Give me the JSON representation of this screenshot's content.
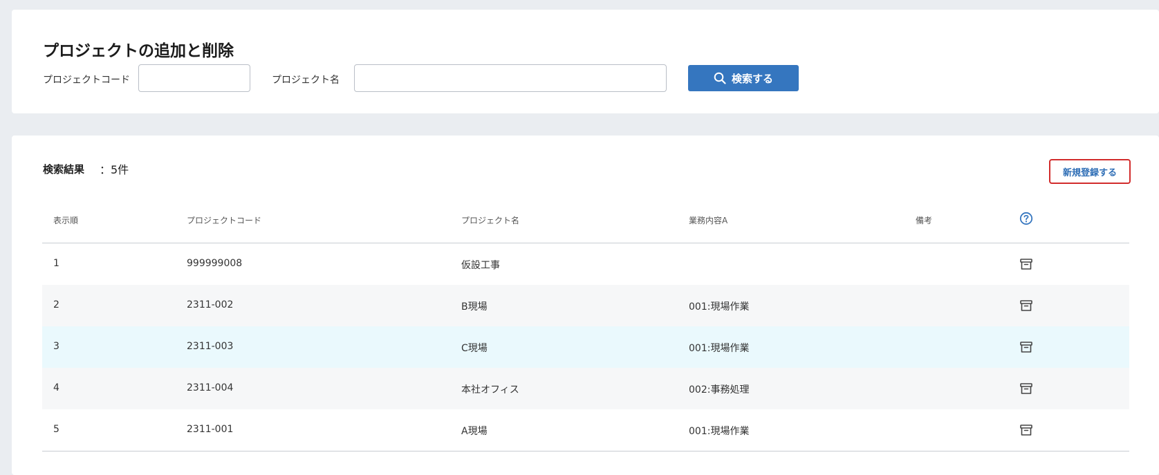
{
  "search": {
    "title": "プロジェクトの追加と削除",
    "code_label": "プロジェクトコード",
    "code_value": "",
    "name_label": "プロジェクト名",
    "name_value": "",
    "button_label": "検索する"
  },
  "results": {
    "label": "検索結果",
    "count": "：5件",
    "new_button_label": "新規登録する",
    "columns": [
      "表示順",
      "プロジェクトコード",
      "プロジェクト名",
      "業務内容A",
      "備考"
    ],
    "rows": [
      {
        "order": "1",
        "code": "999999008",
        "name": "仮設工事",
        "work": "",
        "note": ""
      },
      {
        "order": "2",
        "code": "2311-002",
        "name": "B現場",
        "work": "001:現場作業",
        "note": ""
      },
      {
        "order": "3",
        "code": "2311-003",
        "name": "C現場",
        "work": "001:現場作業",
        "note": ""
      },
      {
        "order": "4",
        "code": "2311-004",
        "name": "本社オフィス",
        "work": "002:事務処理",
        "note": ""
      },
      {
        "order": "5",
        "code": "2311-001",
        "name": "A現場",
        "work": "001:現場作業",
        "note": ""
      }
    ]
  },
  "icons": {
    "search": "search-icon",
    "help": "help-circle-icon",
    "row_action": "archive-icon"
  },
  "colors": {
    "primary": "#3576bf",
    "highlight_border": "#d22b2b",
    "row_highlight": "#eaf9fd"
  }
}
